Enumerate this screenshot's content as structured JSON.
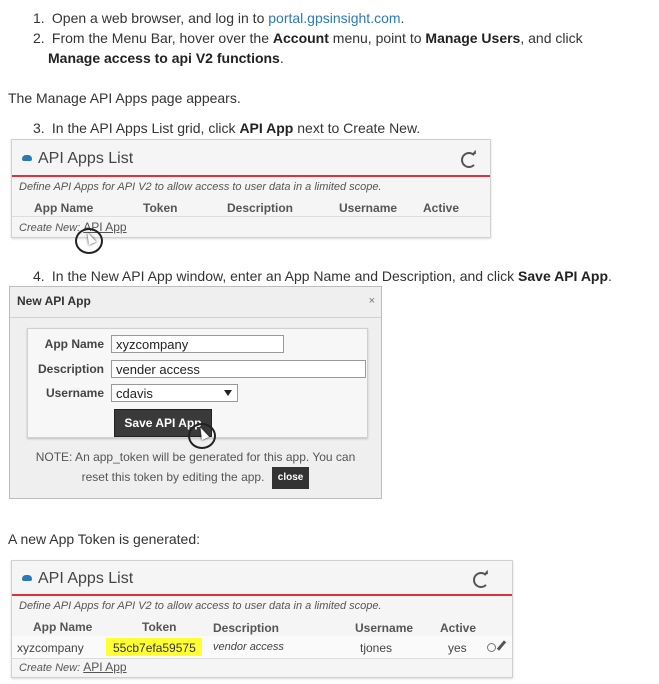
{
  "steps_top": [
    {
      "num": "1.",
      "pre": "Open a web browser, and log in to ",
      "link": "portal.gpsinsight.com",
      "post": "."
    },
    {
      "num": "2.",
      "pre": "From the Menu Bar, hover over the ",
      "b1": "Account",
      "mid1": " menu, point to ",
      "b2": "Manage Users",
      "mid2": ", and click",
      "line2_b": "Manage access to api V2 functions",
      "line2_post": "."
    }
  ],
  "para1": "The Manage API Apps page appears.",
  "step3": {
    "num": "3.",
    "pre": "In the API Apps List grid, click ",
    "b": "API App",
    "post": " next to Create New."
  },
  "panel1": {
    "title": "API Apps List",
    "description": "Define API Apps for API V2 to allow access to user data in a limited scope.",
    "columns": [
      "App Name",
      "Token",
      "Description",
      "Username",
      "Active"
    ],
    "create_new_label": "Create New:",
    "create_new_link": "API App"
  },
  "step4": {
    "num": "4.",
    "pre": "In the New API App window, enter an App Name and Description, and click ",
    "b": "Save API App",
    "post": "."
  },
  "dialog": {
    "title": "New API App",
    "close_x": "×",
    "fields": {
      "app_name_label": "App Name",
      "app_name_value": "xyzcompany",
      "description_label": "Description",
      "description_value": "vender access",
      "username_label": "Username",
      "username_value": "cdavis"
    },
    "save_label": "Save API App",
    "note_line1": "NOTE: An app_token will be generated for this app. You can",
    "note_line2": "reset this token by editing the app.",
    "close_label": "close"
  },
  "para2": "A new App Token is generated:",
  "panel2": {
    "title": "API Apps List",
    "description": "Define API Apps for API V2 to allow access to user data in a limited scope.",
    "columns": [
      "App Name",
      "Token",
      "Description",
      "Username",
      "Active"
    ],
    "row": {
      "app_name": "xyzcompany",
      "token": "55cb7efa59575",
      "description": "vendor access",
      "username": "tjones",
      "active": "yes"
    },
    "create_new_label": "Create New:",
    "create_new_link": "API App"
  },
  "colors": {
    "link": "#2a7ab8",
    "accent_red": "#d9333f",
    "highlight": "#ffff33"
  }
}
